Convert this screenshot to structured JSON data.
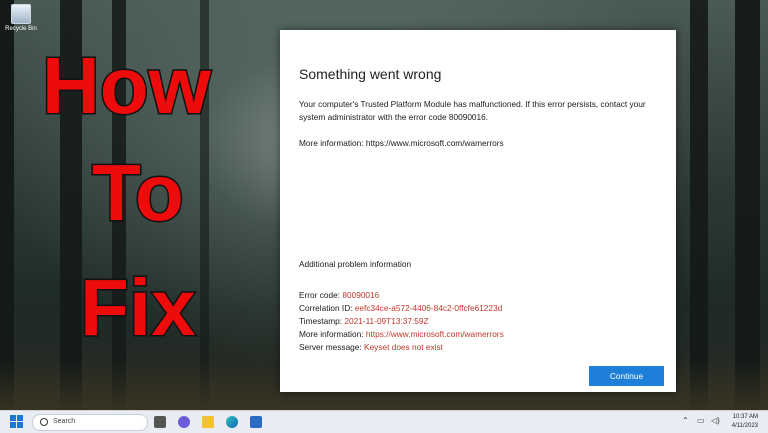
{
  "desktop": {
    "recycle_bin_label": "Recycle Bin"
  },
  "overlay": {
    "line1": "How",
    "line2": "To",
    "line3": "Fix"
  },
  "dialog": {
    "title": "Something went wrong",
    "message": "Your computer's Trusted Platform Module has malfunctioned. If this error persists, contact your system administrator with the error code 80090016.",
    "more_info": "More information: https://www.microsoft.com/wamerrors",
    "additional_heading": "Additional problem information",
    "details": [
      {
        "label": "Error code: ",
        "value": "80090016"
      },
      {
        "label": "Correlation ID: ",
        "value": "eefc34ce-a572-4406-84c2-0ffcfe61223d"
      },
      {
        "label": "Timestamp: ",
        "value": "2021-11-09T13:37:59Z"
      },
      {
        "label": "More information: ",
        "value": "https://www.microsoft.com/wamerrors"
      },
      {
        "label": "Server message: ",
        "value": "Keyset does not exist"
      }
    ],
    "continue_label": "Continue"
  },
  "taskbar": {
    "search_placeholder": "Search",
    "time": "10:37 AM",
    "date": "4/11/2023",
    "accent": "#1d77d8"
  }
}
